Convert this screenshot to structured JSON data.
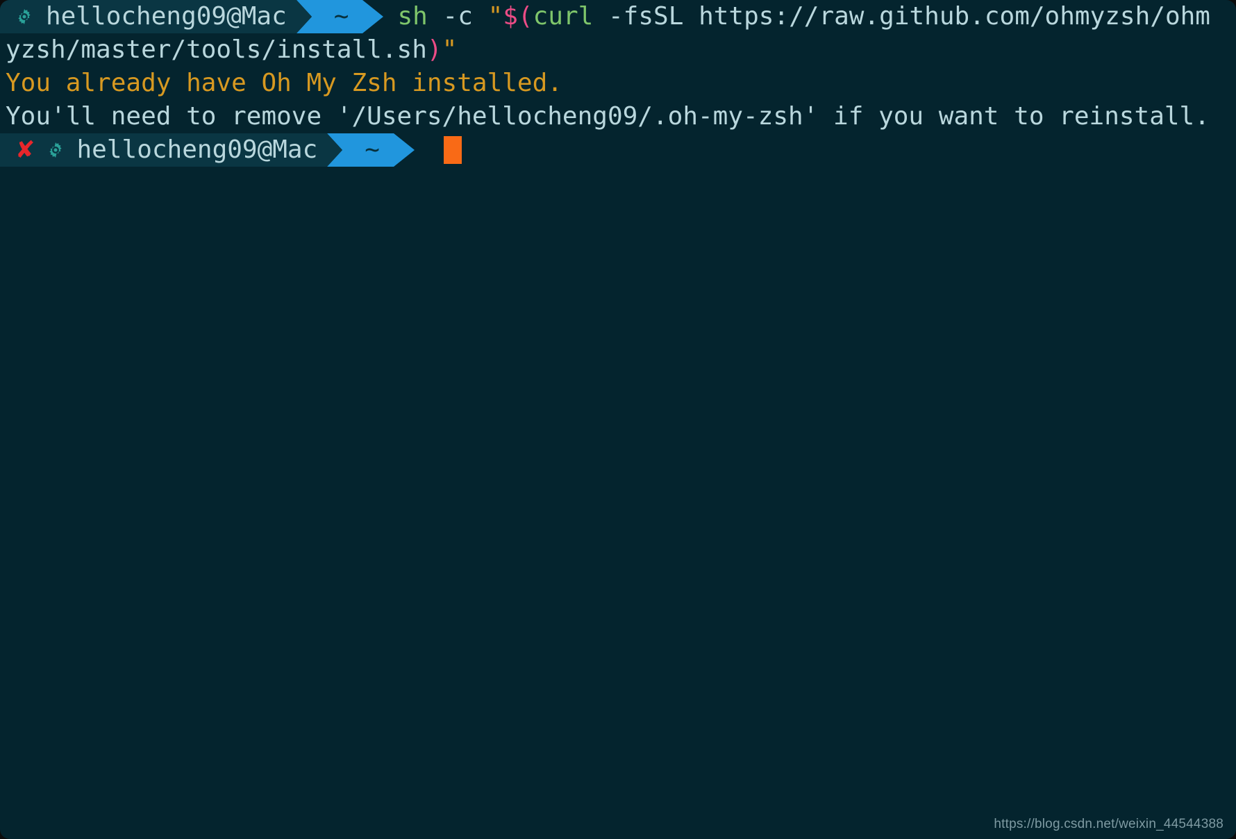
{
  "window": {
    "background": "#04242e",
    "segment_background": "#0a3643",
    "accent_blue": "#2196dd",
    "cursor_color": "#f96a16",
    "error_color": "#e8262b",
    "gear_color": "#2aa198"
  },
  "prompt_line_1": {
    "error_mark": "",
    "gear_icon": "gear-icon",
    "user_host": "hellocheng09@Mac",
    "directory": "~"
  },
  "command": {
    "tok_sh": "sh",
    "tok_space1": " ",
    "tok_flag_c": "-c",
    "tok_space2": " ",
    "tok_openquote": "\"",
    "tok_dollarparen": "$(",
    "tok_curl": "curl",
    "tok_space3": " ",
    "tok_fssl": "-fsSL",
    "tok_space4": " ",
    "tok_url_part1": "https://raw.github.com/ohmyzsh/ohm",
    "tok_url_part2": "yzsh/master/tools/install.sh",
    "tok_closeparen": ")",
    "tok_closequote": "\"",
    "full": "sh -c \"$(curl -fsSL https://raw.github.com/ohmyzsh/ohmyzsh/master/tools/install.sh)\""
  },
  "output": {
    "line_warning": "You already have Oh My Zsh installed.",
    "line_info": "You'll need to remove '/Users/hellocheng09/.oh-my-zsh' if you want to reinstall."
  },
  "prompt_line_2": {
    "error_mark": "✘",
    "gear_icon": "gear-icon",
    "user_host": "hellocheng09@Mac",
    "directory": "~",
    "cursor": "block-cursor"
  },
  "watermark": {
    "text": "https://blog.csdn.net/weixin_44544388"
  }
}
